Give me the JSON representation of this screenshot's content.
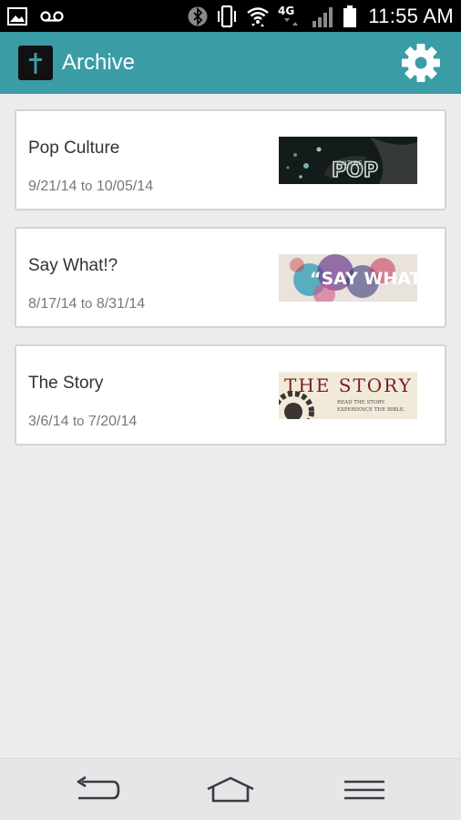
{
  "status_bar": {
    "time": "11:55 AM",
    "network": "4G",
    "icons": [
      "gallery-icon",
      "voicemail-icon",
      "bluetooth-icon",
      "vibrate-icon",
      "wifi-icon",
      "network-4g-icon",
      "signal-icon",
      "battery-icon"
    ]
  },
  "app_bar": {
    "title": "Archive",
    "logo_icon": "cross-icon",
    "settings_icon": "gear-icon"
  },
  "archive": {
    "items": [
      {
        "title": "Pop Culture",
        "date_start": "9/21/14",
        "date_sep": "to",
        "date_end": "10/05/14",
        "thumb_text": "CULTURE",
        "thumb_big": "POP"
      },
      {
        "title": "Say What!?",
        "date_start": "8/17/14",
        "date_sep": "to",
        "date_end": "8/31/14",
        "thumb_text": "“SAY WHAT?!”"
      },
      {
        "title": "The Story",
        "date_start": "3/6/14",
        "date_sep": "to",
        "date_end": "7/20/14",
        "thumb_title": "THE STORY",
        "thumb_line1": "READ THE STORY.",
        "thumb_line2": "EXPERIENCE THE BIBLE."
      }
    ]
  },
  "nav_bar": {
    "back_icon": "back-icon",
    "home_icon": "home-icon",
    "menu_icon": "menu-icon"
  },
  "colors": {
    "accent": "#3a9da6",
    "background": "#ececec",
    "card_border": "#d4d4d4"
  }
}
